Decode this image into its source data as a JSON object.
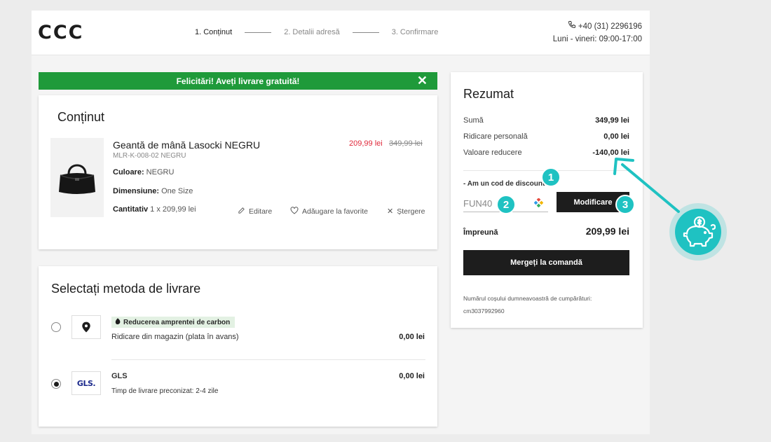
{
  "header": {
    "logo": "CCC",
    "steps": [
      "1. Conținut",
      "2. Detalii adresă",
      "3. Confirmare"
    ],
    "phone": "+40 (31) 2296196",
    "hours": "Luni - vineri: 09:00-17:00"
  },
  "banner": {
    "text": "Felicitări! Aveți livrare gratuită!",
    "close_icon": "close-icon"
  },
  "content": {
    "title": "Conținut",
    "product": {
      "name": "Geantă de mână Lasocki NEGRU",
      "sku": "MLR-K-008-02 NEGRU",
      "color_label": "Culoare:",
      "color_value": " NEGRU",
      "size_label": "Dimensiune:",
      "size_value": " One Size",
      "qty_label": "Cantitativ",
      "qty_value": " 1 x 209,99 lei",
      "price_now": "209,99 lei",
      "price_old": "349,99 lei"
    },
    "actions": {
      "edit": "Editare",
      "favorite": "Adăugare la favorite",
      "delete": "Ștergere"
    }
  },
  "delivery": {
    "title": "Selectați metoda de livrare",
    "options": [
      {
        "badge": "Reducerea amprentei de carbon",
        "name": "Ridicare din magazin (plata în avans)",
        "price": "0,00 lei",
        "selected": false
      },
      {
        "carrier": "GLS",
        "logo_text": "GLS.",
        "estimate": "Timp de livrare preconizat: 2-4 zile",
        "price": "0,00 lei",
        "selected": true
      }
    ]
  },
  "summary": {
    "title": "Rezumat",
    "rows": [
      {
        "label": "Sumă",
        "value": "349,99 lei"
      },
      {
        "label": "Ridicare personală",
        "value": "0,00 lei"
      },
      {
        "label": "Valoare reducere",
        "value": "-140,00 lei"
      }
    ],
    "discount_label": "- Am un cod de discount",
    "discount_code": "FUN40",
    "modify_button": "Modificare",
    "total_label": "Împreună",
    "total_value": "209,99 lei",
    "checkout_button": "Mergeți la comandă",
    "cart_note": "Numărul coșului dumneavoastră de cumpărături:",
    "cart_id": "cm3037992960"
  },
  "annotations": {
    "badges": [
      "1",
      "2",
      "3"
    ],
    "accent_color": "#1fc2c2",
    "icon": "piggy-bank-coin-icon"
  }
}
